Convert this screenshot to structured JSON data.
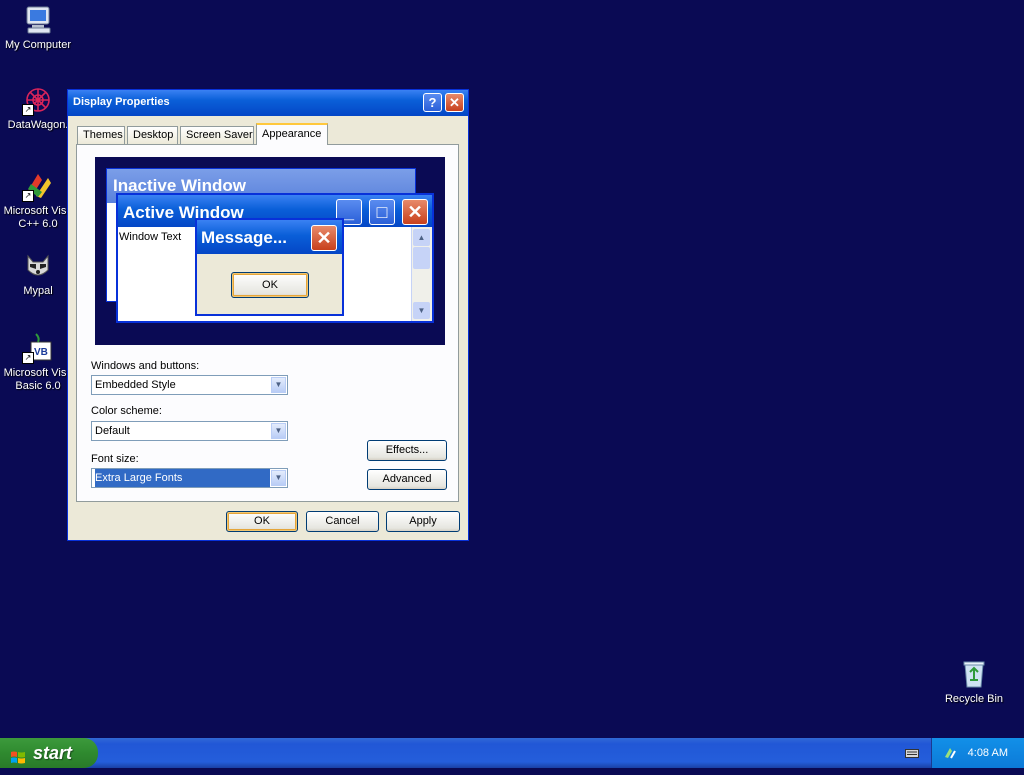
{
  "desktop": {
    "icons": [
      {
        "label": "My Computer",
        "icon": "computer-icon"
      },
      {
        "label": "DataWagon.",
        "icon": "datawagon-icon"
      },
      {
        "label_line1": "Microsoft Visu",
        "label_line2": "C++ 6.0",
        "icon": "visual-cpp-icon"
      },
      {
        "label": "Mypal",
        "icon": "mypal-raccoon-icon"
      },
      {
        "label_line1": "Microsoft Visu",
        "label_line2": "Basic 6.0",
        "icon": "visual-basic-icon"
      },
      {
        "label": "Recycle Bin",
        "icon": "recycle-bin-icon"
      }
    ]
  },
  "window": {
    "title": "Display Properties",
    "help_glyph": "?",
    "close_glyph": "✕",
    "tabs": [
      {
        "label": "Themes",
        "active": false
      },
      {
        "label": "Desktop",
        "active": false
      },
      {
        "label": "Screen Saver",
        "active": false
      },
      {
        "label": "Appearance",
        "active": true
      }
    ],
    "preview": {
      "inactive_title": "Inactive Window",
      "active_title": "Active Window",
      "window_text": "Window Text",
      "message_title": "Message...",
      "ok_label": "OK",
      "minimize_glyph": "_",
      "maximize_glyph": "□",
      "close_glyph": "✕"
    },
    "form": {
      "windows_buttons_label": "Windows and buttons:",
      "windows_buttons_value": "Embedded Style",
      "color_scheme_label": "Color scheme:",
      "color_scheme_value": "Default",
      "font_size_label": "Font size:",
      "font_size_value": "Extra Large Fonts",
      "effects_label": "Effects...",
      "advanced_label": "Advanced"
    },
    "buttons": {
      "ok": "OK",
      "cancel": "Cancel",
      "apply": "Apply"
    }
  },
  "taskbar": {
    "start_label": "start",
    "clock": "4:08 AM"
  },
  "colors": {
    "desktop_bg": "#0a0a54",
    "title_blue": "#0a5fd8",
    "close_red": "#c8401c",
    "start_green": "#2f8a2f",
    "selection": "#316ac5"
  }
}
